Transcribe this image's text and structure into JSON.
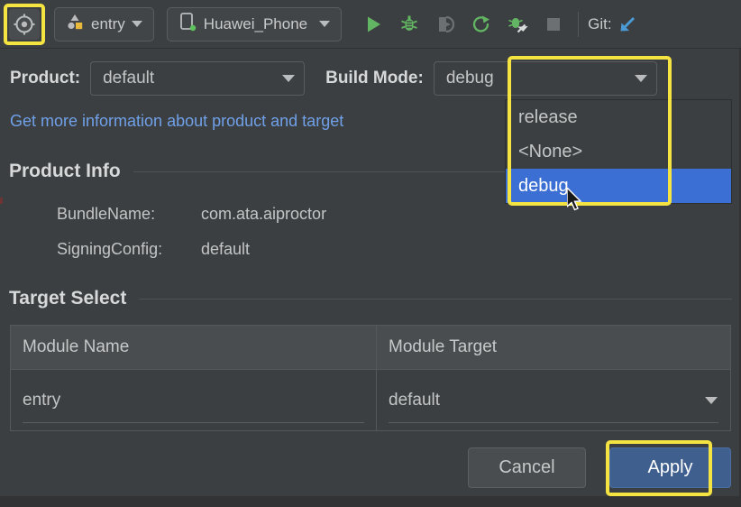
{
  "toolbar": {
    "target_icon": "target-crosshair-icon",
    "module_selector": {
      "label": "entry",
      "icon": "module-entry-icon"
    },
    "device_selector": {
      "label": "Huawei_Phone",
      "icon": "phone-device-icon"
    },
    "actions": [
      {
        "name": "run-button",
        "icon": "play-triangle-icon"
      },
      {
        "name": "debug-button",
        "icon": "bug-icon"
      },
      {
        "name": "run-with-coverage-button",
        "icon": "coverage-shield-icon"
      },
      {
        "name": "rerun-button",
        "icon": "refresh-arrow-icon"
      },
      {
        "name": "attach-debugger-button",
        "icon": "bug-attach-icon"
      },
      {
        "name": "stop-button",
        "icon": "stop-square-icon"
      }
    ],
    "git_label": "Git:",
    "git_update_icon": "git-update-arrow-icon"
  },
  "form": {
    "product_label": "Product:",
    "product_value": "default",
    "build_mode_label": "Build Mode:",
    "build_mode_value": "debug",
    "info_link": "Get more information about product and target"
  },
  "build_mode_dropdown": {
    "options": [
      "release",
      "<None>",
      "debug"
    ],
    "selected": "debug",
    "selected_index": 2
  },
  "product_info": {
    "title": "Product Info",
    "rows": [
      {
        "key": "BundleName:",
        "value": "com.ata.aiproctor"
      },
      {
        "key": "SigningConfig:",
        "value": "default"
      }
    ]
  },
  "target_select": {
    "title": "Target Select",
    "columns": [
      "Module Name",
      "Module Target"
    ],
    "rows": [
      {
        "module_name": "entry",
        "module_target": "default"
      }
    ]
  },
  "footer": {
    "cancel_label": "Cancel",
    "apply_label": "Apply"
  },
  "colors": {
    "background": "#3c3f41",
    "highlight_box": "#f5e342",
    "selection_blue": "#3b6fd4",
    "apply_blue": "#3f5f8f",
    "link_blue": "#6fa0e8",
    "accent_green": "#62b562"
  }
}
